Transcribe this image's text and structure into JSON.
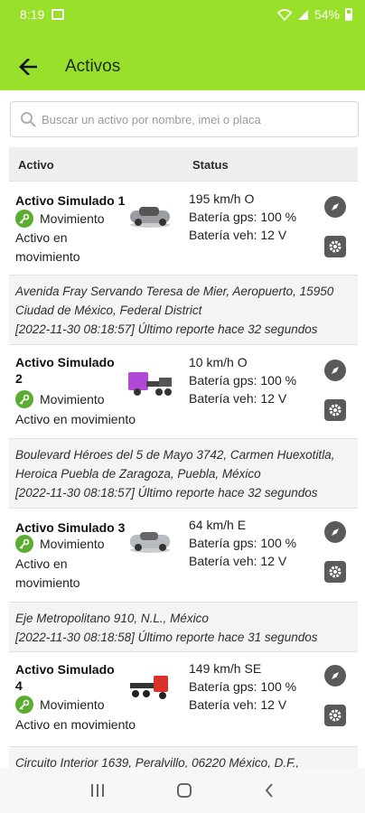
{
  "status_bar": {
    "time": "8:19",
    "battery": "54%"
  },
  "header": {
    "title": "Activos"
  },
  "search": {
    "placeholder": "Buscar un activo por nombre, imei o placa"
  },
  "table": {
    "col_asset": "Activo",
    "col_status": "Status"
  },
  "assets": [
    {
      "name": "Activo Simulado 1",
      "vehicle_icon": "grey-sedan-icon",
      "motion": "Movimiento",
      "description": "Activo en movimiento",
      "speed": "195 km/h O",
      "gps_battery": "Batería gps: 100 %",
      "vehicle_battery": "Batería veh: 12 V",
      "address": "Avenida Fray Servando Teresa de Mier, Aeropuerto, 15950 Ciudad de México, Federal District",
      "report": "[2022-11-30 08:18:57] Último reporte hace 32 segundos"
    },
    {
      "name": "Activo Simulado 2",
      "vehicle_icon": "purple-truck-icon",
      "motion": "Movimiento",
      "description": "Activo en movimiento",
      "speed": "10 km/h O",
      "gps_battery": "Batería gps: 100 %",
      "vehicle_battery": "Batería veh: 12 V",
      "address": "Boulevard Héroes del 5 de Mayo 3742, Carmen Huexotitla, Heroica Puebla de Zaragoza, Puebla, México",
      "report": "[2022-11-30 08:18:57] Último reporte hace 32 segundos"
    },
    {
      "name": "Activo Simulado 3",
      "vehicle_icon": "grey-sedan-icon",
      "motion": "Movimiento",
      "description": "Activo en movimiento",
      "speed": "64 km/h E",
      "gps_battery": "Batería gps: 100 %",
      "vehicle_battery": "Batería veh: 12 V",
      "address": "Eje Metropolitano 910, N.L., México",
      "report": "[2022-11-30 08:18:58] Último reporte hace 31 segundos"
    },
    {
      "name": "Activo Simulado 4",
      "vehicle_icon": "red-truck-icon",
      "motion": "Movimiento",
      "description": "Activo en movimiento",
      "speed": "149 km/h SE",
      "gps_battery": "Batería gps: 100 %",
      "vehicle_battery": "Batería veh: 12 V",
      "address": "Circuito Interior 1639, Peralvillo, 06220 México, D.F.,",
      "report": ""
    }
  ],
  "colors": {
    "accent": "#98e02a",
    "key_icon": "#5aad2f",
    "action_icon": "#5a5a5a"
  }
}
